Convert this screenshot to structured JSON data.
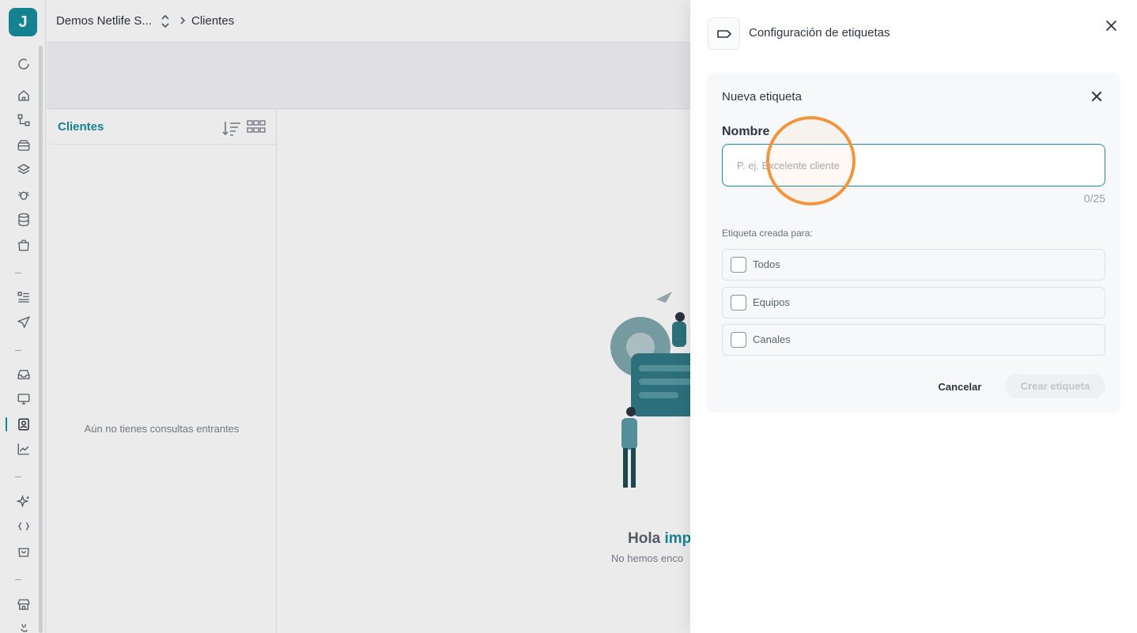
{
  "colors": {
    "accent": "#1a8e9c",
    "click_highlight": "#f2953f"
  },
  "app": {
    "logo_letter": "J",
    "rail_icons": [
      "refresh-icon",
      "home-icon",
      "flow-icon",
      "archive-icon",
      "layers-icon",
      "bug-icon",
      "database-icon",
      "shopping-bag-icon",
      "list-icon",
      "send-icon",
      "inbox-icon",
      "monitor-icon",
      "contact-icon",
      "chart-icon",
      "sparkles-icon",
      "code-braces-icon",
      "cart-icon",
      "store-icon",
      "plug-icon"
    ]
  },
  "breadcrumb": {
    "workspace": "Demos Netlife S...",
    "current": "Clientes"
  },
  "clients_panel": {
    "title": "Clientes",
    "empty_text": "Aún no tienes consultas entrantes"
  },
  "main": {
    "hello_prefix": "Hola",
    "hello_highlight": "impo",
    "subtext": "No hemos enco"
  },
  "drawer": {
    "title": "Configuración de etiquetas",
    "card": {
      "title": "Nueva etiqueta",
      "name_label": "Nombre",
      "name_value": "",
      "name_placeholder": "P. ej. Excelente cliente",
      "counter": "0/25",
      "created_for_label": "Etiqueta creada para:",
      "options": [
        {
          "label": "Todos",
          "checked": false
        },
        {
          "label": "Equipos",
          "checked": false
        },
        {
          "label": "Canales",
          "checked": false
        }
      ],
      "cancel_label": "Cancelar",
      "create_label": "Crear etiqueta"
    }
  }
}
